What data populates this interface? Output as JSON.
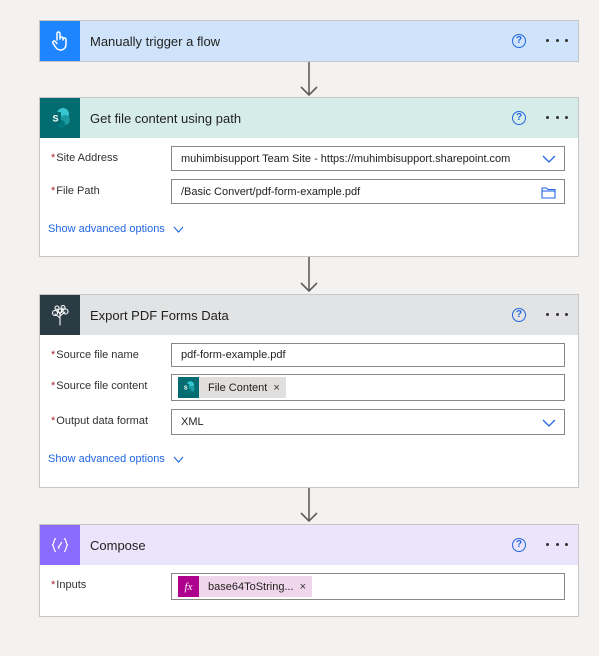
{
  "trigger": {
    "title": "Manually trigger a flow",
    "header_color": "#cfe4fa",
    "icon_color": "#1f85ff",
    "icon": "hand-pointer-icon"
  },
  "get_file": {
    "title": "Get file content using path",
    "header_color": "#d6ece8",
    "icon_color": "#036c70",
    "icon": "sharepoint-icon",
    "fields": {
      "site_address_label": "Site Address",
      "site_address_value": "muhimbisupport Team Site - https://muhimbisupport.sharepoint.com",
      "file_path_label": "File Path",
      "file_path_value": "/Basic Convert/pdf-form-example.pdf"
    },
    "advanced": "Show advanced options"
  },
  "export_pdf": {
    "title": "Export PDF Forms Data",
    "header_color": "#e1e3e4",
    "icon_color": "#2b3b44",
    "icon": "muhimbi-tree-icon",
    "fields": {
      "source_name_label": "Source file name",
      "source_name_value": "pdf-form-example.pdf",
      "source_content_label": "Source file content",
      "source_content_token": "File Content",
      "output_format_label": "Output data format",
      "output_format_value": "XML"
    },
    "advanced": "Show advanced options"
  },
  "compose": {
    "title": "Compose",
    "header_color": "#ebe5fb",
    "icon_color": "#8c6cff",
    "icon": "braces-icon",
    "fields": {
      "inputs_label": "Inputs",
      "inputs_token": "base64ToString..."
    }
  },
  "common": {
    "help": "?",
    "required_mark": "*",
    "remove_token": "×"
  }
}
